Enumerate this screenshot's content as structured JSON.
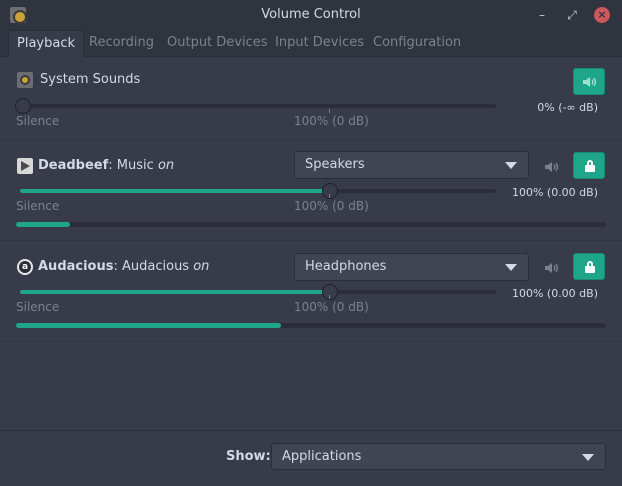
{
  "window": {
    "title": "Volume Control",
    "buttons": {
      "minimize": "–",
      "maximize": "⤢",
      "close": "×"
    }
  },
  "tabs": [
    {
      "label": "Playback",
      "active": true
    },
    {
      "label": "Recording",
      "active": false
    },
    {
      "label": "Output Devices",
      "active": false
    },
    {
      "label": "Input Devices",
      "active": false
    },
    {
      "label": "Configuration",
      "active": false
    }
  ],
  "streams": [
    {
      "name": "System Sounds",
      "volume_percent": 0,
      "volume_text": "0% (-∞ dB)",
      "silence_label": "Silence",
      "reference_label": "100% (0 dB)",
      "mute_button_icon": "speaker-icon"
    },
    {
      "app": "Deadbeef",
      "separator": ": ",
      "media": "Music",
      "on_word": "on",
      "device": "Speakers",
      "volume_percent": 100,
      "volume_text": "100% (0.00 dB)",
      "silence_label": "Silence",
      "reference_label": "100% (0 dB)",
      "level_fraction": 0.09,
      "lock_icon": "lock-icon"
    },
    {
      "app": "Audacious",
      "separator": ": ",
      "media": "Audacious",
      "on_word": "on",
      "device": "Headphones",
      "volume_percent": 100,
      "volume_text": "100% (0.00 dB)",
      "silence_label": "Silence",
      "reference_label": "100% (0 dB)",
      "level_fraction": 0.45,
      "lock_icon": "lock-icon"
    }
  ],
  "footer": {
    "show_label": "Show:",
    "show_value": "Applications"
  },
  "colors": {
    "accent": "#1fa58a",
    "background": "#383c4a",
    "titlebar": "#2f343f",
    "close_button": "#cc575d"
  }
}
